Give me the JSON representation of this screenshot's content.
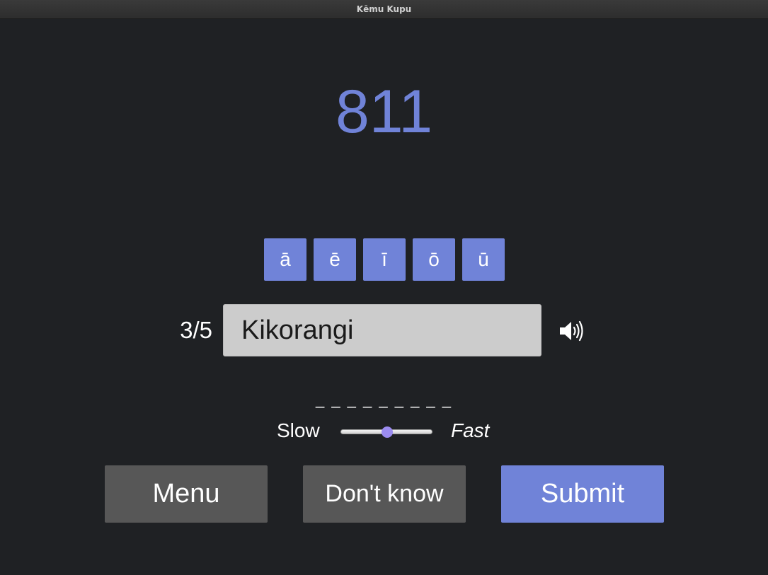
{
  "window": {
    "title": "Kēmu Kupu"
  },
  "prompt": {
    "number": "811"
  },
  "macron_buttons": [
    "ā",
    "ē",
    "ī",
    "ō",
    "ū"
  ],
  "progress": "3/5",
  "answer": {
    "value": "Kikorangi"
  },
  "hint": "_ _ _ _ _ _ _ _ _",
  "speed": {
    "slow_label": "Slow",
    "fast_label": "Fast",
    "value": 0.5
  },
  "buttons": {
    "menu": "Menu",
    "dont_know": "Don't know",
    "submit": "Submit"
  },
  "icons": {
    "speaker": "speaker-volume-icon"
  },
  "colors": {
    "accent": "#7083d8",
    "background": "#1f2124",
    "secondary_button": "#575757",
    "slider_thumb": "#9b8cf0"
  }
}
